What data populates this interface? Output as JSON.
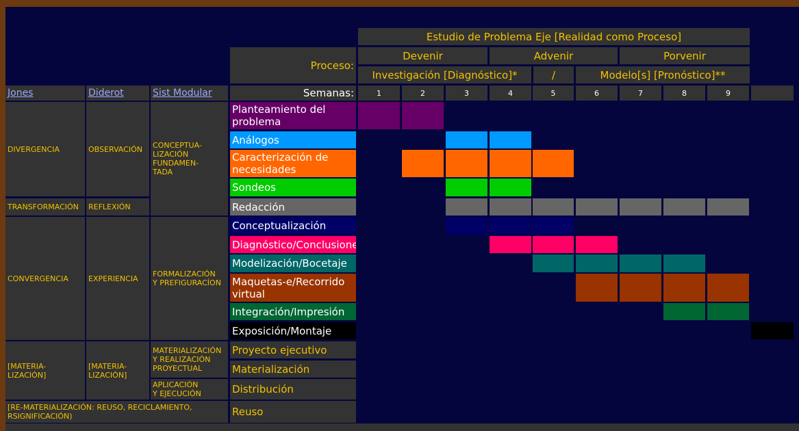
{
  "header": {
    "main_title": "Estudio de Problema Eje [Realidad como Proceso]",
    "proceso_label": "Proceso:",
    "phases": [
      "Devenir",
      "Advenir",
      "Porvenir"
    ],
    "sub_investigacion": "Investigación [Diagnóstico]*",
    "sub_slash": "/",
    "sub_modelo": "Modelo[s] [Pronóstico]**",
    "semanas_label": "Semanas:",
    "weeks": [
      "1",
      "2",
      "3",
      "4",
      "5",
      "6",
      "7",
      "8",
      "9"
    ]
  },
  "columns": {
    "jones": "Jones",
    "diderot": "Diderot",
    "sist_modular": "Sist Modular"
  },
  "side": {
    "divergencia": "DIVERGENCIA",
    "observacion": "OBSERVACIÓN",
    "conceptualizacion": "CONCEPTUA-\nLIZACIÓN\nFUNDAMEN-\nTADA",
    "transformacion": "TRANSFORMACIÓN",
    "reflexion": "REFLEXIÓN",
    "convergencia": "CONVERGENCIA",
    "experiencia": "EXPERIENCIA",
    "formalizacion": "FORMALIZACIÓN\nY PREFIGURACÍON",
    "materializacion_j": "[MATERIA-\nLIZACIÓN]",
    "materializacion_d": "[MATERIA-\nLIZACIÓN]",
    "materializacion_realizacion": "MATERIALIZACIÓN\nY REALIZACIÓN\nPROYECTUAL",
    "aplicacion": "APLICACIÓN\nY EJECUCIÓN",
    "rematerializacion": "[RE-MATERIALIZACIÓN: REUSO, RECICLAMIENTO,\nRSIGNIFICACIÓN)"
  },
  "tasks": [
    {
      "label": "Planteamiento del problema",
      "color": "#660066",
      "weeks": [
        1,
        2
      ],
      "text_color": "white"
    },
    {
      "label": "Análogos",
      "color": "#0099ff",
      "weeks": [
        3,
        4
      ],
      "text_color": "white"
    },
    {
      "label": "Caracterización de necesidades",
      "color": "#ff6600",
      "weeks": [
        2,
        3,
        4,
        5
      ],
      "text_color": "white"
    },
    {
      "label": "Sondeos",
      "color": "#00cc00",
      "weeks": [
        3,
        4
      ],
      "text_color": "white"
    },
    {
      "label": "Redacción",
      "color": "#666666",
      "weeks": [
        3,
        4,
        5,
        6,
        7,
        8,
        9
      ],
      "text_color": "white"
    },
    {
      "label": "Conceptualización",
      "color": "#000066",
      "weeks": [
        3,
        4,
        5
      ],
      "text_color": "white"
    },
    {
      "label": "Diagnóstico/Conclusiones",
      "color": "#ff0066",
      "weeks": [
        4,
        5,
        6
      ],
      "text_color": "white"
    },
    {
      "label": "Modelización/Bocetaje",
      "color": "#006666",
      "weeks": [
        5,
        6,
        7,
        8
      ],
      "text_color": "white"
    },
    {
      "label": "Maquetas-e/Recorrido virtual",
      "color": "#993300",
      "weeks": [
        6,
        7,
        8,
        9
      ],
      "text_color": "white"
    },
    {
      "label": "Integración/Impresión",
      "color": "#006633",
      "weeks": [
        8,
        9
      ],
      "text_color": "white"
    },
    {
      "label": "Exposición/Montaje",
      "color": "#000000",
      "weeks": [
        10
      ],
      "text_color": "white"
    },
    {
      "label": "Proyecto ejecutivo",
      "color": "#333333",
      "weeks": [],
      "text_color": "yellow"
    },
    {
      "label": "Materialización",
      "color": "#333333",
      "weeks": [],
      "text_color": "yellow"
    },
    {
      "label": "Distribución",
      "color": "#333333",
      "weeks": [],
      "text_color": "yellow"
    },
    {
      "label": "Reuso",
      "color": "#333333",
      "weeks": [],
      "text_color": "yellow"
    }
  ]
}
